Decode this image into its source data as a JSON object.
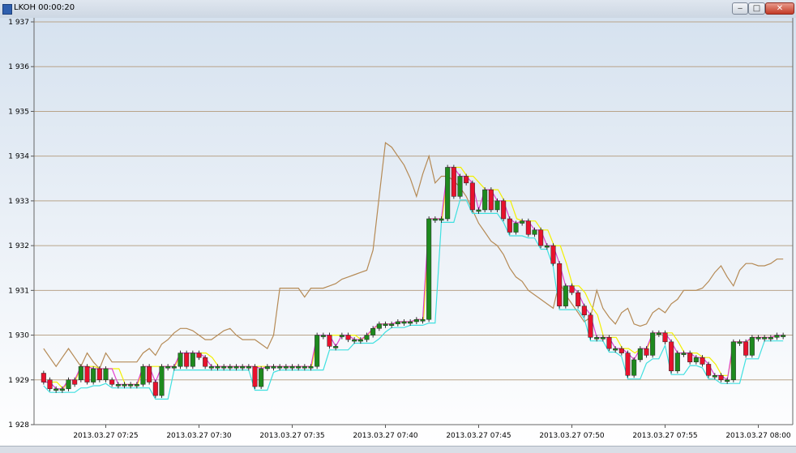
{
  "window": {
    "title": "LKOH 00:00:20",
    "buttons": {
      "minimize": "‒",
      "maximize": "□",
      "close": "✕"
    }
  },
  "chart_data": {
    "type": "candlestick",
    "grid": true,
    "ylim": [
      1928,
      1937
    ],
    "y_ticks": [
      "1 937",
      "1 936",
      "1 935",
      "1 934",
      "1 933",
      "1 932",
      "1 931",
      "1 930",
      "1 929",
      "1 928"
    ],
    "x_ticks": [
      {
        "label": "2013.03.27 07:25",
        "t": 10
      },
      {
        "label": "2013.03.27 07:30",
        "t": 25
      },
      {
        "label": "2013.03.27 07:35",
        "t": 40
      },
      {
        "label": "2013.03.27 07:40",
        "t": 55
      },
      {
        "label": "2013.03.27 07:45",
        "t": 70
      },
      {
        "label": "2013.03.27 07:50",
        "t": 85
      },
      {
        "label": "2013.03.27 07:55",
        "t": 100
      },
      {
        "label": "2013.03.27 08:00",
        "t": 115
      }
    ],
    "candles": [
      [
        1929.15,
        1928.95
      ],
      [
        1929.0,
        1928.8
      ],
      [
        1928.8,
        1928.8
      ],
      [
        1928.8,
        1928.8
      ],
      [
        1928.8,
        1929.0
      ],
      [
        1929.0,
        1928.9
      ],
      [
        1929.0,
        1929.3
      ],
      [
        1929.3,
        1928.95
      ],
      [
        1928.95,
        1929.25
      ],
      [
        1929.25,
        1929.0
      ],
      [
        1929.0,
        1929.25
      ],
      [
        1929.0,
        1928.9
      ],
      [
        1928.9,
        1928.9
      ],
      [
        1928.9,
        1928.9
      ],
      [
        1928.9,
        1928.9
      ],
      [
        1928.9,
        1928.9
      ],
      [
        1928.9,
        1929.3
      ],
      [
        1929.3,
        1928.95
      ],
      [
        1928.95,
        1928.65
      ],
      [
        1928.65,
        1929.3
      ],
      [
        1929.3,
        1929.3
      ],
      [
        1929.3,
        1929.3
      ],
      [
        1929.3,
        1929.6
      ],
      [
        1929.6,
        1929.3
      ],
      [
        1929.3,
        1929.6
      ],
      [
        1929.6,
        1929.5
      ],
      [
        1929.5,
        1929.3
      ],
      [
        1929.3,
        1929.3
      ],
      [
        1929.3,
        1929.3
      ],
      [
        1929.3,
        1929.3
      ],
      [
        1929.3,
        1929.3
      ],
      [
        1929.3,
        1929.3
      ],
      [
        1929.3,
        1929.3
      ],
      [
        1929.3,
        1929.3
      ],
      [
        1929.3,
        1928.85
      ],
      [
        1928.85,
        1929.25
      ],
      [
        1929.25,
        1929.3
      ],
      [
        1929.3,
        1929.3
      ],
      [
        1929.3,
        1929.3
      ],
      [
        1929.3,
        1929.3
      ],
      [
        1929.3,
        1929.3
      ],
      [
        1929.3,
        1929.3
      ],
      [
        1929.3,
        1929.3
      ],
      [
        1929.3,
        1929.3
      ],
      [
        1929.3,
        1930.0
      ],
      [
        1930.0,
        1930.0
      ],
      [
        1930.0,
        1929.75
      ],
      [
        1929.75,
        1929.75
      ],
      [
        1930.0,
        1930.0
      ],
      [
        1930.0,
        1929.9
      ],
      [
        1929.9,
        1929.9
      ],
      [
        1929.9,
        1929.9
      ],
      [
        1929.9,
        1930.0
      ],
      [
        1930.0,
        1930.15
      ],
      [
        1930.15,
        1930.25
      ],
      [
        1930.25,
        1930.25
      ],
      [
        1930.25,
        1930.25
      ],
      [
        1930.25,
        1930.3
      ],
      [
        1930.3,
        1930.3
      ],
      [
        1930.3,
        1930.3
      ],
      [
        1930.3,
        1930.35
      ],
      [
        1930.35,
        1930.35
      ],
      [
        1930.35,
        1932.6
      ],
      [
        1932.6,
        1932.6
      ],
      [
        1932.6,
        1932.6
      ],
      [
        1932.6,
        1933.75
      ],
      [
        1933.75,
        1933.1
      ],
      [
        1933.1,
        1933.55
      ],
      [
        1933.55,
        1933.4
      ],
      [
        1933.4,
        1932.8
      ],
      [
        1932.8,
        1932.8
      ],
      [
        1932.8,
        1933.25
      ],
      [
        1933.25,
        1932.8
      ],
      [
        1932.8,
        1933.0
      ],
      [
        1933.0,
        1932.6
      ],
      [
        1932.6,
        1932.3
      ],
      [
        1932.3,
        1932.5
      ],
      [
        1932.5,
        1932.55
      ],
      [
        1932.55,
        1932.25
      ],
      [
        1932.25,
        1932.35
      ],
      [
        1932.35,
        1932.0
      ],
      [
        1932.0,
        1932.0
      ],
      [
        1932.0,
        1931.6
      ],
      [
        1931.6,
        1930.65
      ],
      [
        1930.65,
        1931.1
      ],
      [
        1931.1,
        1930.95
      ],
      [
        1930.95,
        1930.65
      ],
      [
        1930.65,
        1930.45
      ],
      [
        1930.45,
        1929.95
      ],
      [
        1929.95,
        1929.95
      ],
      [
        1929.95,
        1929.95
      ],
      [
        1929.95,
        1929.7
      ],
      [
        1929.7,
        1929.7
      ],
      [
        1929.7,
        1929.6
      ],
      [
        1929.6,
        1929.1
      ],
      [
        1929.1,
        1929.45
      ],
      [
        1929.45,
        1929.7
      ],
      [
        1929.7,
        1929.55
      ],
      [
        1929.55,
        1930.05
      ],
      [
        1930.05,
        1930.05
      ],
      [
        1930.05,
        1929.85
      ],
      [
        1929.85,
        1929.2
      ],
      [
        1929.2,
        1929.6
      ],
      [
        1929.6,
        1929.6
      ],
      [
        1929.6,
        1929.4
      ],
      [
        1929.4,
        1929.5
      ],
      [
        1929.5,
        1929.35
      ],
      [
        1929.35,
        1929.1
      ],
      [
        1929.1,
        1929.1
      ],
      [
        1929.1,
        1929.0
      ],
      [
        1929.0,
        1929.0
      ],
      [
        1929.0,
        1929.85
      ],
      [
        1929.85,
        1929.85
      ],
      [
        1929.85,
        1929.55
      ],
      [
        1929.55,
        1929.95
      ],
      [
        1929.95,
        1929.95
      ],
      [
        1929.95,
        1929.95
      ],
      [
        1929.95,
        1929.95
      ],
      [
        1929.95,
        1930.0
      ],
      [
        1930.0,
        1930.0
      ]
    ],
    "channel_upper": [
      1929.7,
      1929.5,
      1929.3,
      1929.5,
      1929.7,
      1929.5,
      1929.3,
      1929.6,
      1929.4,
      1929.25,
      1929.6,
      1929.4,
      1929.4,
      1929.4,
      1929.4,
      1929.4,
      1929.6,
      1929.7,
      1929.55,
      1929.8,
      1929.9,
      1930.05,
      1930.15,
      1930.15,
      1930.1,
      1930.0,
      1929.9,
      1929.9,
      1930.0,
      1930.1,
      1930.15,
      1930.0,
      1929.9,
      1929.9,
      1929.9,
      1929.8,
      1929.7,
      1930.0,
      1931.05,
      1931.05,
      1931.05,
      1931.05,
      1930.85,
      1931.05,
      1931.05,
      1931.05,
      1931.1,
      1931.15,
      1931.25,
      1931.3,
      1931.35,
      1931.4,
      1931.45,
      1931.9,
      1933.1,
      1934.3,
      1934.2,
      1934.0,
      1933.8,
      1933.5,
      1933.1,
      1933.6,
      1934.0,
      1933.4,
      1933.55,
      1933.55,
      1933.45,
      1933.3,
      1933.1,
      1932.8,
      1932.5,
      1932.3,
      1932.1,
      1932.0,
      1931.8,
      1931.5,
      1931.3,
      1931.2,
      1931.0,
      1930.9,
      1930.8,
      1930.7,
      1930.6,
      1931.2,
      1930.9,
      1930.7,
      1930.5,
      1930.3,
      1930.4,
      1931.0,
      1930.6,
      1930.4,
      1930.25,
      1930.5,
      1930.6,
      1930.25,
      1930.2,
      1930.25,
      1930.5,
      1930.6,
      1930.5,
      1930.7,
      1930.8,
      1931.0,
      1931.0,
      1931.0,
      1931.05,
      1931.2,
      1931.4,
      1931.55,
      1931.3,
      1931.1,
      1931.45,
      1931.6,
      1931.6,
      1931.55,
      1931.55,
      1931.6,
      1931.7,
      1931.7
    ]
  }
}
